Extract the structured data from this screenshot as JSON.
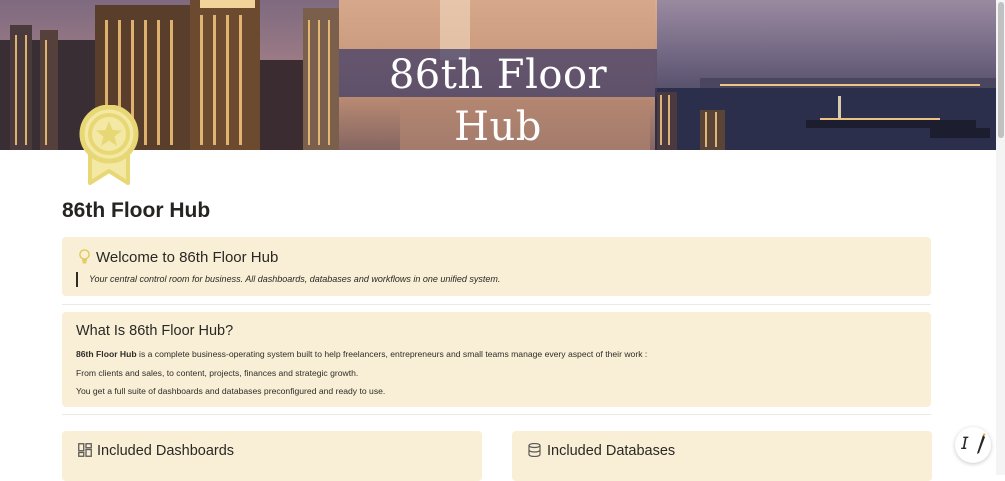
{
  "cover": {
    "title": "86th Floor Hub"
  },
  "page": {
    "title": "86th Floor Hub",
    "icon": "award-ribbon-icon"
  },
  "welcome": {
    "heading": "Welcome to 86th Floor Hub",
    "icon": "lightbulb-icon",
    "quote": "Your central control room for business. All dashboards, databases and workflows in one unified system."
  },
  "what": {
    "heading": "What Is 86th Floor Hub?",
    "line1_bold": "86th Floor Hub",
    "line1_rest": " is a complete business-operating system built to help freelancers, entrepreneurs and small teams manage every aspect of their work :",
    "line2": "From clients and sales, to content, projects, finances and strategic growth.",
    "line3": "You get a full suite of dashboards and databases preconfigured and ready to use."
  },
  "dashboards": {
    "heading": "Included Dashboards",
    "icon": "grid-icon"
  },
  "databases": {
    "heading": "Included Databases",
    "icon": "database-icon"
  },
  "assistant": {
    "icon": "notion-ai-icon"
  },
  "colors": {
    "callout_bg": "#f8efd6",
    "icon_gold": "#e8d775",
    "title_band": "#3c3a66"
  }
}
